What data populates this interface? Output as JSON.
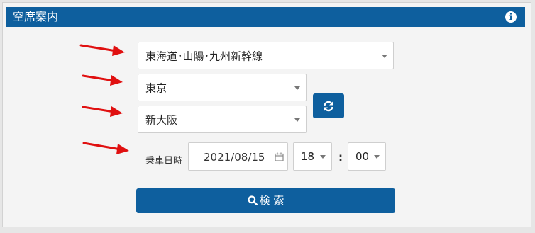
{
  "header": {
    "title": "空席案内",
    "info_icon": "info-icon"
  },
  "route": {
    "line": "東海道･山陽･九州新幹線",
    "from": "東京",
    "to": "新大阪"
  },
  "swap_icon": "refresh-icon",
  "datetime": {
    "label": "乗車日時",
    "date": "2021/08/15",
    "hour": "18",
    "separator": ":",
    "minute": "00"
  },
  "search": {
    "label": "検 索",
    "icon": "search-icon"
  },
  "colors": {
    "accent": "#0e5f9e",
    "annotation_arrow": "#e01010"
  }
}
